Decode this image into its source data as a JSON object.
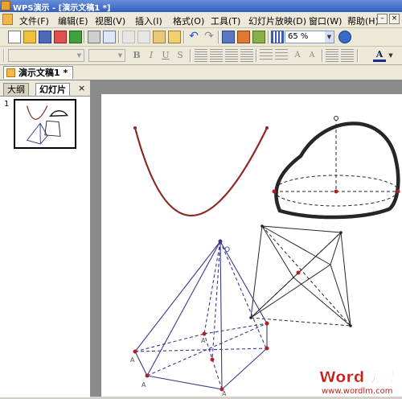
{
  "window": {
    "title": "WPS演示 - [演示文稿1 *]"
  },
  "menubar": {
    "items": [
      "文件(F)",
      "编辑(E)",
      "视图(V)",
      "插入(I)",
      "格式(O)",
      "工具(T)",
      "幻灯片放映(D)",
      "窗口(W)",
      "帮助(H)"
    ]
  },
  "toolbar": {
    "zoom": "65 %",
    "format_buttons": [
      "B",
      "I",
      "U",
      "S"
    ]
  },
  "doc_tab": {
    "label": "演示文稿1 *"
  },
  "left_panel": {
    "tabs": [
      "大纲",
      "幻灯片"
    ],
    "close_glyph": "×",
    "slide_number": "1"
  },
  "slide": {
    "point_labels": [
      "O",
      "A",
      "A",
      "A",
      "A"
    ]
  },
  "watermark": {
    "brand": "Word联盟",
    "url": "www.wordlm.com"
  },
  "colors": {
    "parabola": "#8b2a24",
    "pyramid": "#3a3a8c",
    "dome": "#262626",
    "point": "#b02020"
  }
}
